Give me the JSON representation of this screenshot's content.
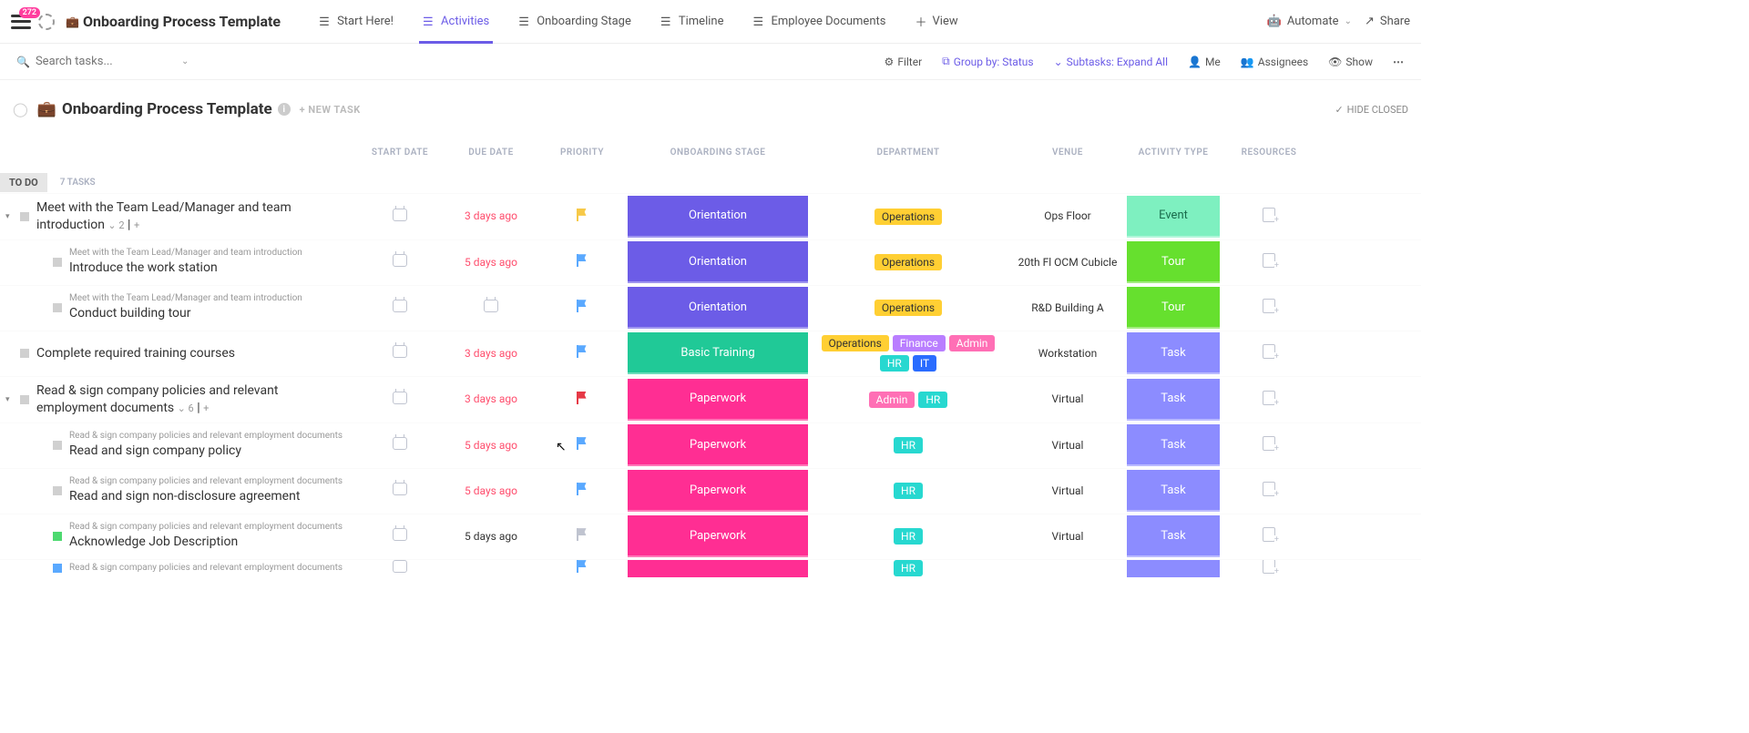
{
  "header": {
    "badge": "272",
    "icon": "💼",
    "title": "Onboarding Process Template",
    "tabs": [
      {
        "label": "Start Here!"
      },
      {
        "label": "Activities",
        "active": true
      },
      {
        "label": "Onboarding Stage"
      },
      {
        "label": "Timeline"
      },
      {
        "label": "Employee Documents"
      },
      {
        "label": "View",
        "plus": true
      }
    ],
    "right": {
      "automate": "Automate",
      "share": "Share"
    }
  },
  "toolbar": {
    "search_placeholder": "Search tasks...",
    "filter": "Filter",
    "group": "Group by: Status",
    "subtasks": "Subtasks: Expand All",
    "me": "Me",
    "assignees": "Assignees",
    "show": "Show"
  },
  "list": {
    "icon": "💼",
    "title": "Onboarding Process Template",
    "new_task": "+ NEW TASK",
    "hide": "HIDE CLOSED",
    "columns": {
      "start": "START DATE",
      "due": "DUE DATE",
      "prio": "PRIORITY",
      "stage": "ONBOARDING STAGE",
      "dept": "DEPARTMENT",
      "venue": "VENUE",
      "act": "ACTIVITY TYPE",
      "res": "RESOURCES"
    },
    "group": {
      "label": "TO DO",
      "count": "7 TASKS"
    }
  },
  "tasks": [
    {
      "name": "Meet with the Team Lead/Manager and team introduction",
      "subcount": "2",
      "due": "3 days ago",
      "due_red": true,
      "flag": "yel",
      "stage": "Orientation",
      "stage_cls": "st-ori",
      "dept": [
        {
          "t": "Operations",
          "c": "t-ops"
        }
      ],
      "venue": "Ops Floor",
      "act": "Event",
      "act_cls": "a-ev",
      "exp": true
    },
    {
      "sub": true,
      "parent": "Meet with the Team Lead/Manager and team introduction",
      "name": "Introduce the work station",
      "due": "5 days ago",
      "due_red": true,
      "flag": "blu",
      "stage": "Orientation",
      "stage_cls": "st-ori",
      "dept": [
        {
          "t": "Operations",
          "c": "t-ops"
        }
      ],
      "venue": "20th Fl OCM Cubicle",
      "act": "Tour",
      "act_cls": "a-tr"
    },
    {
      "sub": true,
      "parent": "Meet with the Team Lead/Manager and team introduction",
      "name": "Conduct building tour",
      "due": "",
      "flag": "blu",
      "stage": "Orientation",
      "stage_cls": "st-ori",
      "dept": [
        {
          "t": "Operations",
          "c": "t-ops"
        }
      ],
      "venue": "R&D Building A",
      "act": "Tour",
      "act_cls": "a-tr",
      "due_cal": true
    },
    {
      "name": "Complete required training courses",
      "due": "3 days ago",
      "due_red": true,
      "flag": "blu",
      "stage": "Basic Training",
      "stage_cls": "st-bt",
      "dept": [
        {
          "t": "Operations",
          "c": "t-ops"
        },
        {
          "t": "Finance",
          "c": "t-fin"
        },
        {
          "t": "Admin",
          "c": "t-adm"
        },
        {
          "t": "HR",
          "c": "t-hr"
        },
        {
          "t": "IT",
          "c": "t-it"
        }
      ],
      "venue": "Workstation",
      "act": "Task",
      "act_cls": "a-tk"
    },
    {
      "name": "Read & sign company policies and relevant employment documents",
      "subcount": "6",
      "due": "3 days ago",
      "due_red": true,
      "flag": "red",
      "stage": "Paperwork",
      "stage_cls": "st-pw",
      "dept": [
        {
          "t": "Admin",
          "c": "t-adm"
        },
        {
          "t": "HR",
          "c": "t-hr"
        }
      ],
      "venue": "Virtual",
      "act": "Task",
      "act_cls": "a-tk",
      "exp": true
    },
    {
      "sub": true,
      "parent": "Read & sign company policies and relevant employment documents",
      "name": "Read and sign company policy",
      "due": "5 days ago",
      "due_red": true,
      "flag": "blu",
      "stage": "Paperwork",
      "stage_cls": "st-pw",
      "dept": [
        {
          "t": "HR",
          "c": "t-hr"
        }
      ],
      "venue": "Virtual",
      "act": "Task",
      "act_cls": "a-tk"
    },
    {
      "sub": true,
      "parent": "Read & sign company policies and relevant employment documents",
      "name": "Read and sign non-disclosure agreement",
      "due": "5 days ago",
      "due_red": true,
      "flag": "blu",
      "stage": "Paperwork",
      "stage_cls": "st-pw",
      "dept": [
        {
          "t": "HR",
          "c": "t-hr"
        }
      ],
      "venue": "Virtual",
      "act": "Task",
      "act_cls": "a-tk"
    },
    {
      "sub": true,
      "parent": "Read & sign company policies and relevant employment documents",
      "name": "Acknowledge Job Description",
      "due": "5 days ago",
      "due_red": false,
      "flag": "gry",
      "stage": "Paperwork",
      "stage_cls": "st-pw",
      "dept": [
        {
          "t": "HR",
          "c": "t-hr"
        }
      ],
      "venue": "Virtual",
      "act": "Task",
      "act_cls": "a-tk",
      "chk": "grn"
    },
    {
      "sub": true,
      "parent": "Read & sign company policies and relevant employment documents",
      "name": "",
      "due": "",
      "flag": "blu",
      "stage": "",
      "stage_cls": "st-pw",
      "dept": [
        {
          "t": "HR",
          "c": "t-hr"
        }
      ],
      "venue": "",
      "act": "",
      "act_cls": "a-tk",
      "chk": "blu",
      "cut": true
    }
  ]
}
